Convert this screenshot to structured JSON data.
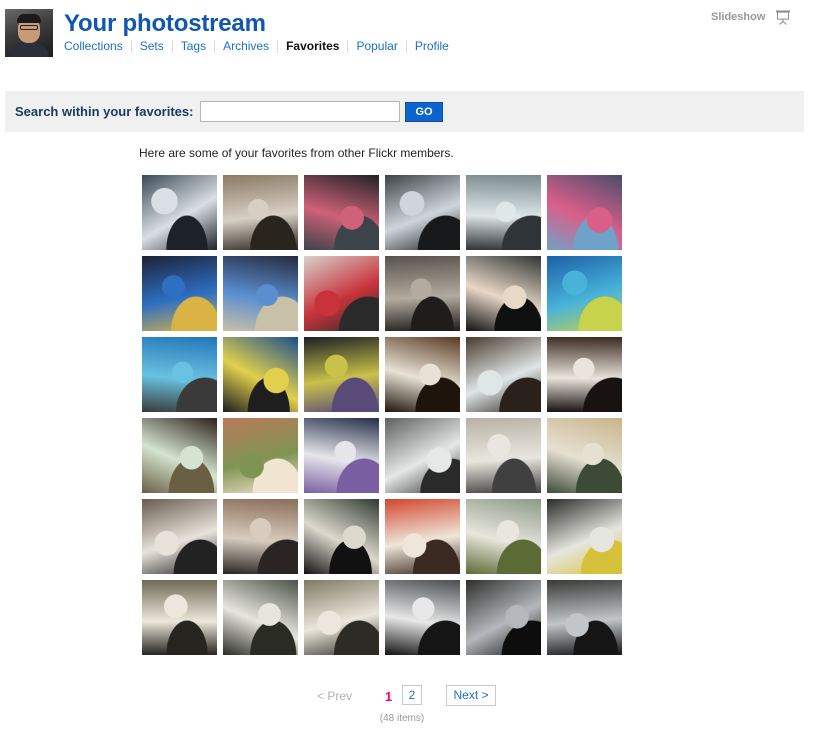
{
  "header": {
    "title": "Your photostream",
    "nav": [
      {
        "label": "Collections",
        "current": false
      },
      {
        "label": "Sets",
        "current": false
      },
      {
        "label": "Tags",
        "current": false
      },
      {
        "label": "Archives",
        "current": false
      },
      {
        "label": "Favorites",
        "current": true
      },
      {
        "label": "Popular",
        "current": false
      },
      {
        "label": "Profile",
        "current": false
      }
    ],
    "slideshow_label": "Slideshow"
  },
  "search": {
    "label": "Search within your favorites:",
    "value": "",
    "placeholder": "",
    "button_label": "GO"
  },
  "intro_text": "Here are some of your favorites from other Flickr members.",
  "thumbnails": [
    {
      "bg": "#3b4a55",
      "mid": "#d9dfe4",
      "accent": "#1d2229"
    },
    {
      "bg": "#8a7a66",
      "mid": "#d8cfc4",
      "accent": "#2a241e"
    },
    {
      "bg": "#1f2326",
      "mid": "#cf6178",
      "accent": "#3c4349"
    },
    {
      "bg": "#3f4347",
      "mid": "#cfd6db",
      "accent": "#17191b"
    },
    {
      "bg": "#7a8a8e",
      "mid": "#dfe7e8",
      "accent": "#2e3438"
    },
    {
      "bg": "#4a4d6c",
      "mid": "#d95f89",
      "accent": "#6fa2c8"
    },
    {
      "bg": "#1c2238",
      "mid": "#2e6fc2",
      "accent": "#d9b445"
    },
    {
      "bg": "#262b3e",
      "mid": "#5a8ed0",
      "accent": "#c9c0a8"
    },
    {
      "bg": "#d6d2cc",
      "mid": "#c8333b",
      "accent": "#2a2a2a"
    },
    {
      "bg": "#58534c",
      "mid": "#b3ab9f",
      "accent": "#1f1c19"
    },
    {
      "bg": "#2f3432",
      "mid": "#e8d8c8",
      "accent": "#0f1010"
    },
    {
      "bg": "#1b5fa8",
      "mid": "#48b2d9",
      "accent": "#c7d44b"
    },
    {
      "bg": "#2277b8",
      "mid": "#69c2e2",
      "accent": "#3a3a3a"
    },
    {
      "bg": "#1b4f8c",
      "mid": "#e1d04d",
      "accent": "#1e1e1e"
    },
    {
      "bg": "#1c1f24",
      "mid": "#c8c14a",
      "accent": "#5a4a7a"
    },
    {
      "bg": "#5a3a22",
      "mid": "#e8e2d6",
      "accent": "#1f140c"
    },
    {
      "bg": "#4a3b2d",
      "mid": "#dfe6e6",
      "accent": "#2a211b"
    },
    {
      "bg": "#3a2a1f",
      "mid": "#e9e4dc",
      "accent": "#181210"
    },
    {
      "bg": "#2b211b",
      "mid": "#d4e4d0",
      "accent": "#6a5f42"
    },
    {
      "bg": "#b97a5a",
      "mid": "#7f9452",
      "accent": "#f1e4d0"
    },
    {
      "bg": "#252e48",
      "mid": "#e6e6ea",
      "accent": "#7a5ea2"
    },
    {
      "bg": "#5e6060",
      "mid": "#e6e8e8",
      "accent": "#2a2a2a"
    },
    {
      "bg": "#b8b2a4",
      "mid": "#e9e6df",
      "accent": "#404040"
    },
    {
      "bg": "#c8b48a",
      "mid": "#e6e0d2",
      "accent": "#3c4a36"
    },
    {
      "bg": "#6a5c4e",
      "mid": "#e7e3db",
      "accent": "#222222"
    },
    {
      "bg": "#8a6e58",
      "mid": "#d8ccbf",
      "accent": "#2a2522"
    },
    {
      "bg": "#2f3a30",
      "mid": "#dcd8cc",
      "accent": "#111111"
    },
    {
      "bg": "#d2472f",
      "mid": "#efe6d9",
      "accent": "#3a2a22"
    },
    {
      "bg": "#8c9a88",
      "mid": "#e8e6dd",
      "accent": "#5c6a35"
    },
    {
      "bg": "#2a2c28",
      "mid": "#e6e6e0",
      "accent": "#d6c23a"
    },
    {
      "bg": "#6e6a55",
      "mid": "#ece7da",
      "accent": "#262520"
    },
    {
      "bg": "#4c5348",
      "mid": "#e7e6dd",
      "accent": "#2a2c24"
    },
    {
      "bg": "#807a64",
      "mid": "#ebe7dc",
      "accent": "#2c2b24"
    },
    {
      "bg": "#4a4e52",
      "mid": "#e8e8e8",
      "accent": "#151515"
    },
    {
      "bg": "#2e2f2c",
      "mid": "#b4b8bc",
      "accent": "#0d0d0d"
    },
    {
      "bg": "#3a3b38",
      "mid": "#c2c6c9",
      "accent": "#151515"
    }
  ],
  "pagination": {
    "prev_label": "< Prev",
    "pages": [
      "1",
      "2"
    ],
    "current_page": "1",
    "next_label": "Next >",
    "count_text": "(48 items)"
  },
  "colors": {
    "title": "#1057ae",
    "link": "#1e6fc7",
    "current_page": "#ff0084",
    "search_button": "#0b63ce",
    "search_bar_bg": "#f0f0f0"
  }
}
